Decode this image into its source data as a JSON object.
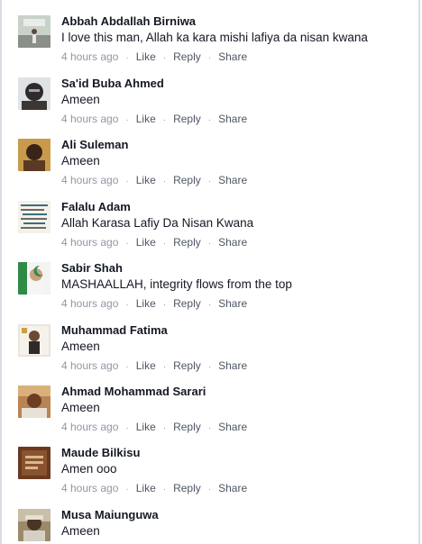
{
  "comments": [
    {
      "author": "Abbah Abdallah Birniwa",
      "text": "I love this man, Allah ka kara mishi lafiya da nisan kwana",
      "time": "4 hours ago",
      "like": "Like",
      "reply": "Reply",
      "share": "Share",
      "avatar": "avatar-photo-icon"
    },
    {
      "author": "Sa'id Buba Ahmed",
      "text": "Ameen",
      "time": "4 hours ago",
      "like": "Like",
      "reply": "Reply",
      "share": "Share",
      "avatar": "avatar-photo-icon"
    },
    {
      "author": "Ali Suleman",
      "text": "Ameen",
      "time": "4 hours ago",
      "like": "Like",
      "reply": "Reply",
      "share": "Share",
      "avatar": "avatar-photo-icon"
    },
    {
      "author": "Falalu Adam",
      "text": "Allah Karasa Lafiy Da Nisan Kwana",
      "time": "4 hours ago",
      "like": "Like",
      "reply": "Reply",
      "share": "Share",
      "avatar": "avatar-photo-icon"
    },
    {
      "author": "Sabir Shah",
      "text": "MASHAALLAH, integrity flows from the top",
      "time": "4 hours ago",
      "like": "Like",
      "reply": "Reply",
      "share": "Share",
      "avatar": "avatar-photo-icon"
    },
    {
      "author": "Muhammad Fatima",
      "text": "Ameen",
      "time": "4 hours ago",
      "like": "Like",
      "reply": "Reply",
      "share": "Share",
      "avatar": "avatar-photo-icon"
    },
    {
      "author": "Ahmad Mohammad Sarari",
      "text": "Ameen",
      "time": "4 hours ago",
      "like": "Like",
      "reply": "Reply",
      "share": "Share",
      "avatar": "avatar-photo-icon"
    },
    {
      "author": "Maude Bilkisu",
      "text": "Amen ooo",
      "time": "4 hours ago",
      "like": "Like",
      "reply": "Reply",
      "share": "Share",
      "avatar": "avatar-photo-icon"
    },
    {
      "author": "Musa Maiunguwa",
      "text": "Ameen",
      "avatar": "avatar-photo-icon"
    }
  ],
  "separator": "·",
  "colors": {
    "author": "#141823",
    "meta": "#9197a3",
    "link": "#4e5665"
  }
}
